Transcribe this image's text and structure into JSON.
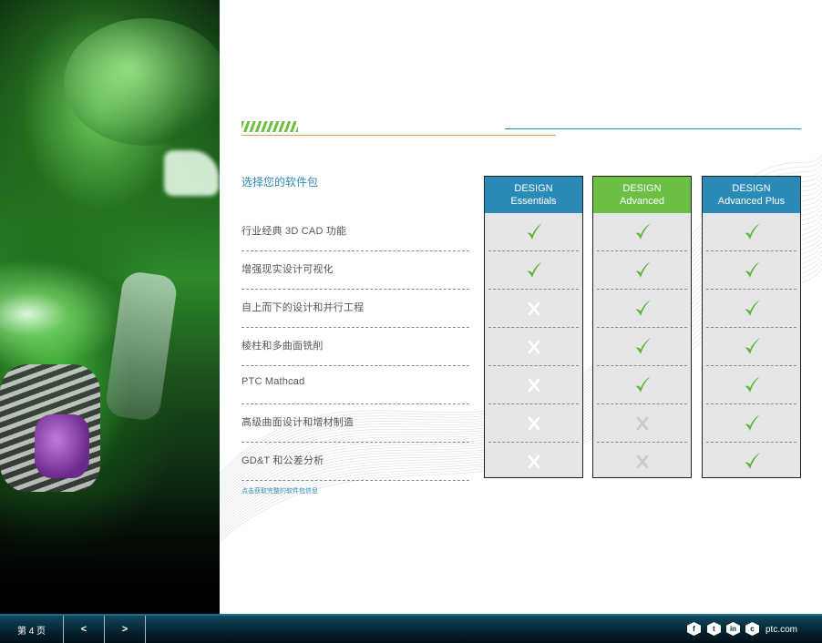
{
  "section_title": "选择您的软件包",
  "features": [
    "行业经典 3D CAD 功能",
    "增强现实设计可视化",
    "自上而下的设计和并行工程",
    "棱柱和多曲面铣削",
    "PTC Mathcad",
    "高级曲面设计和增材制造",
    "GD&T 和公差分析"
  ],
  "link_text": "点击获取完整的软件包信息",
  "packages": [
    {
      "line1": "DESIGN",
      "line2": "Essentials",
      "color": "#2a8bb8",
      "support": [
        true,
        true,
        false,
        false,
        false,
        false,
        false
      ]
    },
    {
      "line1": "DESIGN",
      "line2": "Advanced",
      "color": "#6cbf45",
      "support": [
        true,
        true,
        true,
        true,
        true,
        false,
        false
      ]
    },
    {
      "line1": "DESIGN",
      "line2": "Advanced Plus",
      "color": "#2a8bb8",
      "support": [
        true,
        true,
        true,
        true,
        true,
        true,
        true
      ]
    }
  ],
  "colors": {
    "check": "#5bb130",
    "cross": "#ffffff",
    "cross_dim": "#c8c9cb"
  },
  "footer": {
    "page_label": "第 4 页",
    "prev": "<",
    "next": ">",
    "social": [
      {
        "name": "facebook-icon",
        "glyph": "f"
      },
      {
        "name": "twitter-icon",
        "glyph": "t"
      },
      {
        "name": "linkedin-icon",
        "glyph": "in"
      },
      {
        "name": "ptc-icon",
        "glyph": "c"
      }
    ],
    "site": "ptc.com"
  }
}
